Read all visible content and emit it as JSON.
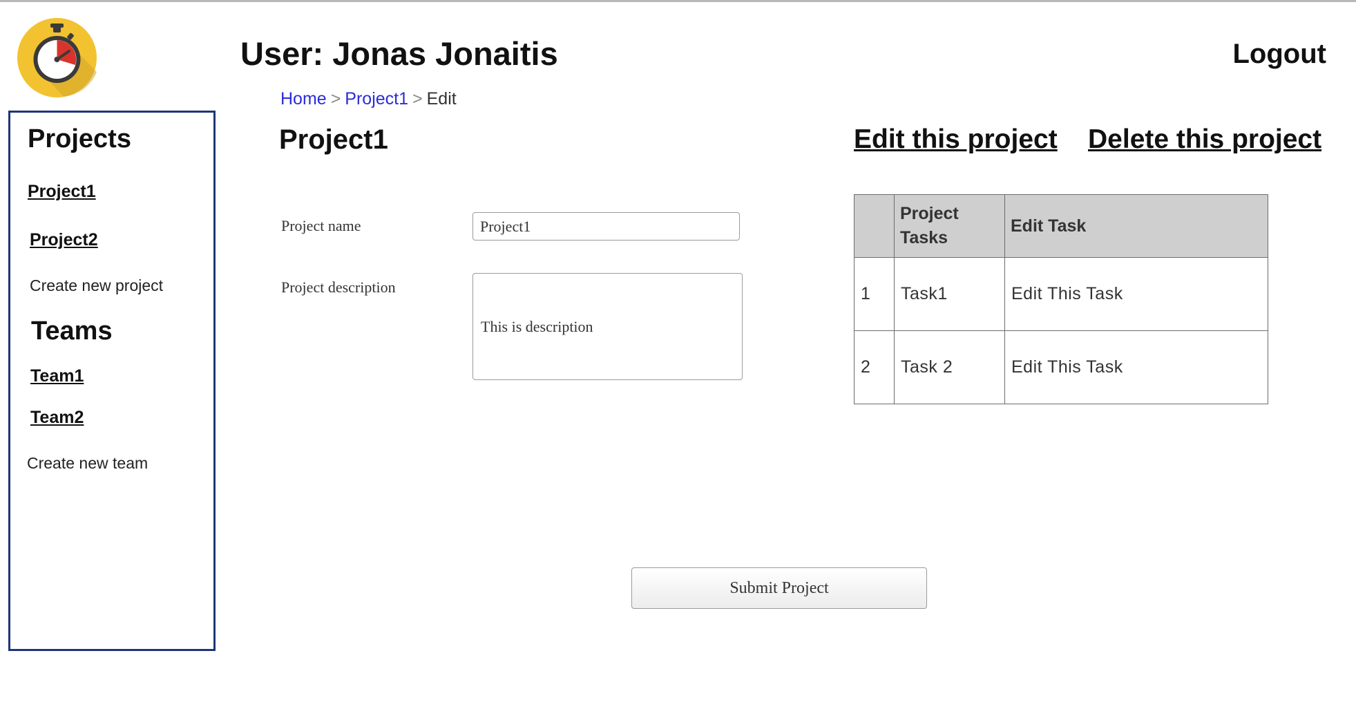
{
  "header": {
    "user_title": "User: Jonas Jonaitis",
    "logout_label": "Logout",
    "logo_icon": "stopwatch-icon"
  },
  "breadcrumb": {
    "items": [
      "Home",
      "Project1",
      "Edit"
    ],
    "separator": ">"
  },
  "sidebar": {
    "projects_heading": "Projects",
    "projects": [
      "Project1",
      "Project2"
    ],
    "create_project_label": "Create new project",
    "teams_heading": "Teams",
    "teams": [
      "Team1",
      "Team2"
    ],
    "create_team_label": "Create new team"
  },
  "main": {
    "project_title": "Project1",
    "edit_project_label": "Edit this project",
    "delete_project_label": "Delete this project"
  },
  "form": {
    "name_label": "Project name",
    "name_value": "Project1",
    "description_label": "Project description",
    "description_value": "This is description",
    "submit_label": "Submit Project"
  },
  "tasks_table": {
    "headers": [
      "",
      "Project Tasks",
      "Edit Task"
    ],
    "rows": [
      {
        "num": "1",
        "task": "Task1",
        "action": "Edit This Task"
      },
      {
        "num": "2",
        "task": "Task 2",
        "action": "Edit This Task"
      }
    ]
  },
  "colors": {
    "sidebar_border": "#1f3478",
    "breadcrumb_link": "#2b2bdb",
    "table_header_bg": "#cfcfcf",
    "logo_yellow": "#f2c230",
    "logo_red": "#d9342b"
  }
}
